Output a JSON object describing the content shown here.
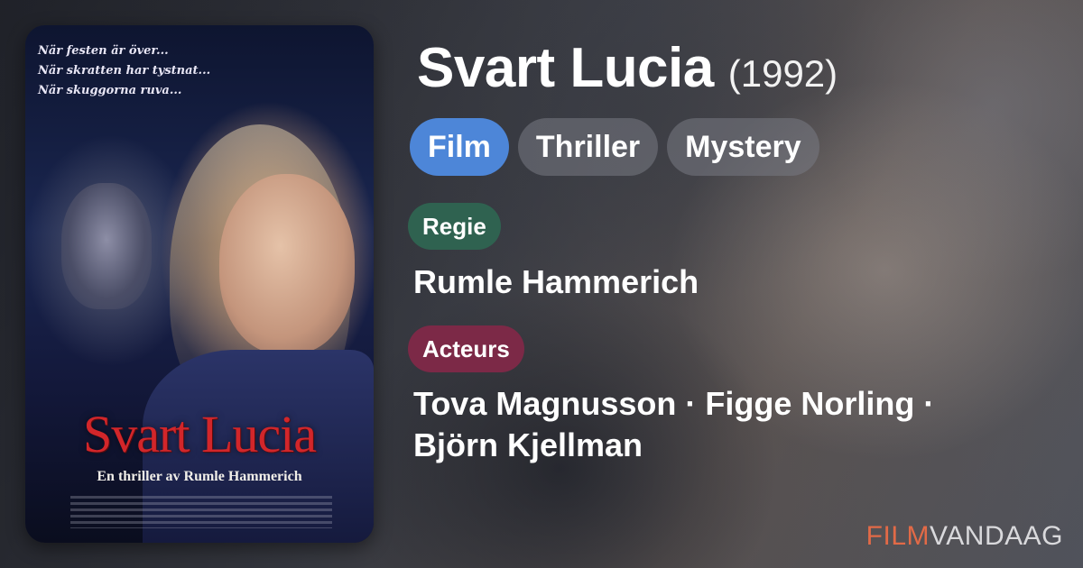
{
  "poster": {
    "tagline": [
      "När festen är över...",
      "När skratten har tystnat...",
      "När skuggorna ruva..."
    ],
    "title": "Svart Lucia",
    "subtitle": "En thriller av Rumle Hammerich"
  },
  "movie": {
    "title": "Svart Lucia",
    "year": "(1992)"
  },
  "genres": [
    "Film",
    "Thriller",
    "Mystery"
  ],
  "director_section": {
    "label": "Regie",
    "name": "Rumle Hammerich"
  },
  "actors_section": {
    "label": "Acteurs",
    "names": "Tova Magnusson · Figge Norling · Björn Kjellman"
  },
  "brand": {
    "part1": "FILM",
    "part2": "VANDAAG"
  },
  "colors": {
    "film_tag": "#4d86d8",
    "regie_label": "#2f6250",
    "acteurs_label": "#7c2947",
    "brand_accent": "#e26a47"
  }
}
